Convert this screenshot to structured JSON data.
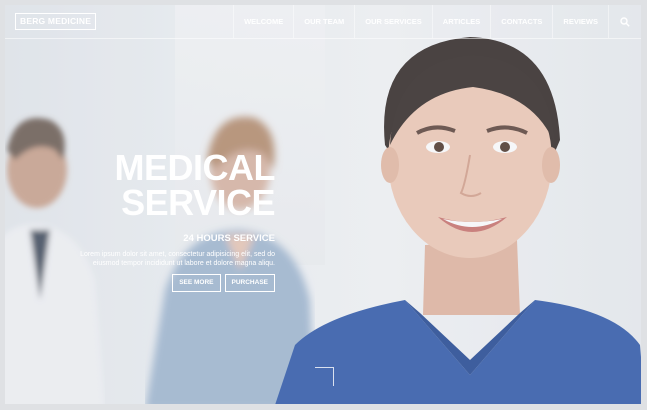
{
  "site": {
    "logo": "BERG MEDICINE"
  },
  "nav": {
    "items": [
      {
        "label": "WELCOME"
      },
      {
        "label": "OUR TEAM"
      },
      {
        "label": "OUR SERVICES"
      },
      {
        "label": "ARTICLES"
      },
      {
        "label": "CONTACTS"
      },
      {
        "label": "REVIEWS"
      }
    ],
    "search_icon": "search-icon"
  },
  "hero": {
    "title_line1": "MEDICAL",
    "title_line2": "SERVICE",
    "subtitle": "24 HOURS SERVICE",
    "body_line1": "Lorem ipsum dolor sit amet, consectetur adipisicing elit, sed do",
    "body_line2": "eiusmod tempor incididunt ut labore et dolore magna aliqu.",
    "buttons": {
      "see_more": "SEE MORE",
      "purchase": "PURCHASE"
    }
  },
  "colors": {
    "text": "#ffffff",
    "scrub": "#2c56a8"
  }
}
